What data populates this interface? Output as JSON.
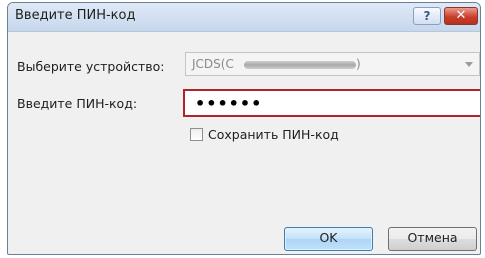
{
  "dialog": {
    "title": "Введите ПИН-код",
    "help_glyph": "?",
    "close_glyph": "✕"
  },
  "device": {
    "label": "Выберите устройство:",
    "value": "JCDS(C",
    "value_tail": ")"
  },
  "pin": {
    "label": "Введите ПИН-код:",
    "value": "••••••"
  },
  "save_pin": {
    "label": "Сохранить ПИН-код",
    "checked": false
  },
  "buttons": {
    "ok": "OK",
    "cancel": "Отмена"
  },
  "colors": {
    "pin_highlight": "#b1232a",
    "close_button": "#c8402c",
    "ok_border": "#3c7fb1"
  }
}
